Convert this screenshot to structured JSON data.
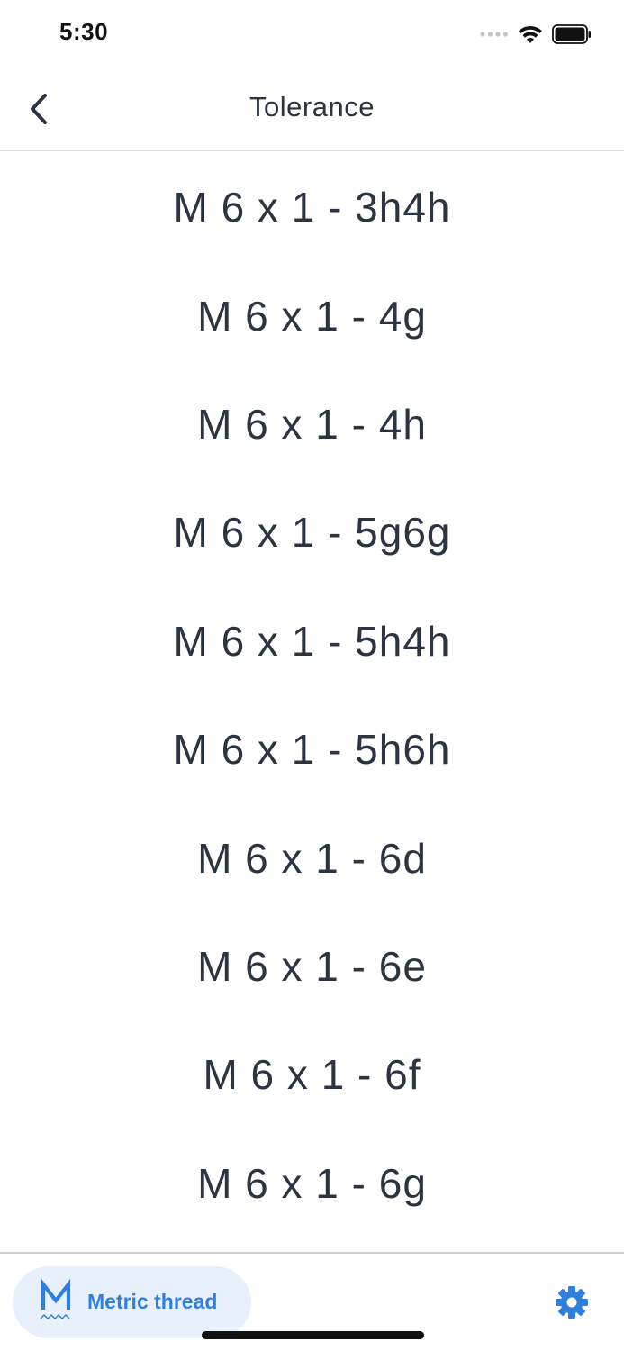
{
  "status_bar": {
    "time": "5:30"
  },
  "nav": {
    "title": "Tolerance",
    "back_icon": "chevron-left-icon"
  },
  "tolerances": [
    "M 6 x 1 - 3h4h",
    "M 6 x 1 - 4g",
    "M 6 x 1 - 4h",
    "M 6 x 1 - 5g6g",
    "M 6 x 1 - 5h4h",
    "M 6 x 1 - 5h6h",
    "M 6 x 1 - 6d",
    "M 6 x 1 - 6e",
    "M 6 x 1 - 6f",
    "M 6 x 1 - 6g"
  ],
  "bottom_bar": {
    "chip_label": "Metric thread",
    "chip_icon": "metric-thread-icon",
    "settings_icon": "gear-icon"
  },
  "colors": {
    "accent": "#2f7fde",
    "chip_background": "#e8f0fc",
    "text": "#2b3440"
  }
}
